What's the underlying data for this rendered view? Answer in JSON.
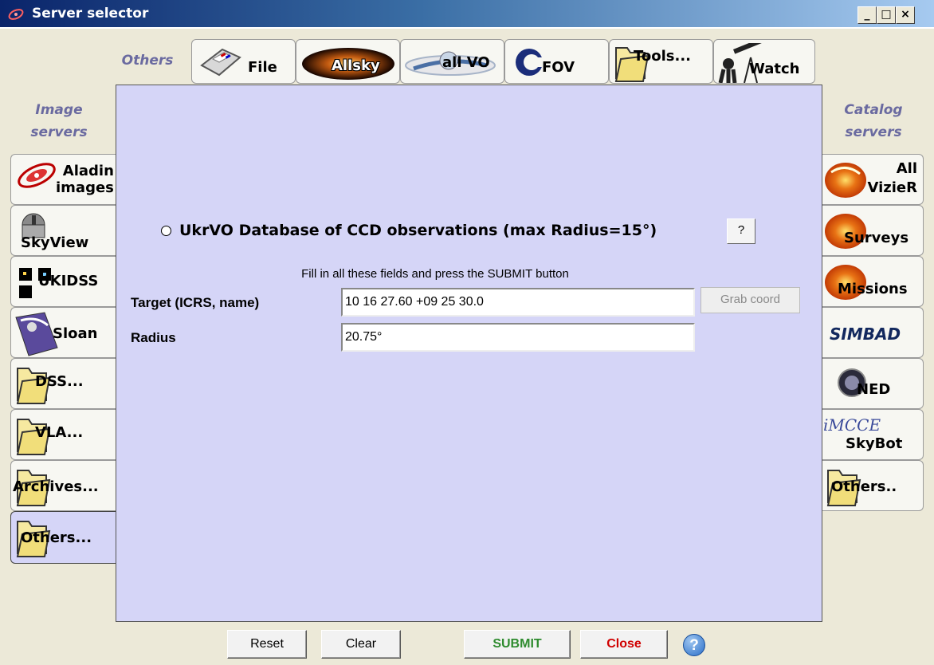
{
  "window": {
    "title": "Server selector",
    "minimize": "_",
    "maximize": "□",
    "close": "×"
  },
  "groups": {
    "others": "Others",
    "image_servers": "Image\nservers",
    "catalog_servers": "Catalog\nservers"
  },
  "top_tabs": [
    {
      "label": "File",
      "icon": "floppy-disk-icon"
    },
    {
      "label": "Allsky",
      "icon": "allsky-icon"
    },
    {
      "label": "all VO",
      "icon": "vo-icon"
    },
    {
      "label": "FOV",
      "icon": "fov-icon"
    },
    {
      "label": "Tools...",
      "icon": "folder-icon"
    },
    {
      "label": "Watch",
      "icon": "telescope-icon"
    }
  ],
  "left_tabs": [
    {
      "label": "Aladin\nimages",
      "icon": "aladin-icon"
    },
    {
      "label": "SkyView",
      "icon": "skyview-observatory-icon"
    },
    {
      "label": "UKIDSS",
      "icon": "ukidss-icon"
    },
    {
      "label": "Sloan",
      "icon": "sloan-icon"
    },
    {
      "label": "DSS...",
      "icon": "folder-icon"
    },
    {
      "label": "VLA...",
      "icon": "folder-icon"
    },
    {
      "label": "Archives...",
      "icon": "folder-icon"
    },
    {
      "label": "Others...",
      "icon": "folder-icon"
    }
  ],
  "right_tabs": [
    {
      "label": "All\nVizieR",
      "icon": "vizier-galaxy-icon"
    },
    {
      "label": "Surveys",
      "icon": "galaxy-icon"
    },
    {
      "label": "Missions",
      "icon": "galaxy-icon"
    },
    {
      "label": "SIMBAD",
      "icon": "simbad-logo-icon"
    },
    {
      "label": "NED",
      "icon": "ned-icon"
    },
    {
      "label": "SkyBot",
      "icon": "imcce-icon"
    },
    {
      "label": "Others..",
      "icon": "folder-icon"
    }
  ],
  "panel": {
    "server_title": "UkrVO Database of CCD observations (max Radius=15°)",
    "help_label": "?",
    "instructions": "Fill in all these fields and press the SUBMIT button",
    "target_label": "Target (ICRS, name)",
    "target_value": "10 16 27.60 +09 25 30.0",
    "grab_label": "Grab coord",
    "radius_label": "Radius",
    "radius_value": "20.75°"
  },
  "buttons": {
    "reset": "Reset",
    "clear": "Clear",
    "submit": "SUBMIT",
    "close": "Close",
    "help": "?"
  },
  "colors": {
    "panel_bg": "#d5d5f7",
    "window_bg": "#ece9d8",
    "submit": "#2e8b2e",
    "close": "#d00000"
  }
}
